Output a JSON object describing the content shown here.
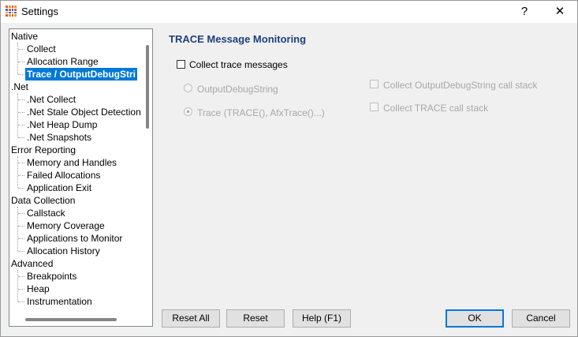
{
  "window": {
    "title": "Settings",
    "help_glyph": "?",
    "close_glyph": "✕"
  },
  "tree": {
    "items": [
      {
        "label": "Native",
        "level": 0
      },
      {
        "label": "Collect",
        "level": 1
      },
      {
        "label": "Allocation Range",
        "level": 1
      },
      {
        "label": "Trace / OutputDebugStri",
        "level": 1,
        "selected": true
      },
      {
        "label": ".Net",
        "level": 0
      },
      {
        "label": ".Net Collect",
        "level": 1
      },
      {
        "label": ".Net Stale Object Detection",
        "level": 1
      },
      {
        "label": ".Net Heap Dump",
        "level": 1
      },
      {
        "label": ".Net Snapshots",
        "level": 1
      },
      {
        "label": "Error Reporting",
        "level": 0
      },
      {
        "label": "Memory and Handles",
        "level": 1
      },
      {
        "label": "Failed Allocations",
        "level": 1
      },
      {
        "label": "Application Exit",
        "level": 1
      },
      {
        "label": "Data Collection",
        "level": 0
      },
      {
        "label": "Callstack",
        "level": 1
      },
      {
        "label": "Memory Coverage",
        "level": 1
      },
      {
        "label": "Applications to Monitor",
        "level": 1
      },
      {
        "label": "Allocation History",
        "level": 1
      },
      {
        "label": "Advanced",
        "level": 0
      },
      {
        "label": "Breakpoints",
        "level": 1
      },
      {
        "label": "Heap",
        "level": 1
      },
      {
        "label": "Instrumentation",
        "level": 1
      }
    ]
  },
  "panel": {
    "heading": "TRACE Message Monitoring",
    "collect_trace_label": "Collect trace messages",
    "collect_trace_checked": false,
    "radio_outputdebugstring": "OutputDebugString",
    "radio_trace": "Trace (TRACE(), AfxTrace()...)",
    "radio_trace_selected": true,
    "check_ods_callstack": "Collect OutputDebugString call stack",
    "check_trace_callstack": "Collect TRACE call stack"
  },
  "buttons": {
    "reset_all": "Reset All",
    "reset": "Reset",
    "help": "Help (F1)",
    "ok": "OK",
    "cancel": "Cancel"
  },
  "colors": {
    "selection": "#0078d7",
    "heading": "#1f3f7f"
  }
}
